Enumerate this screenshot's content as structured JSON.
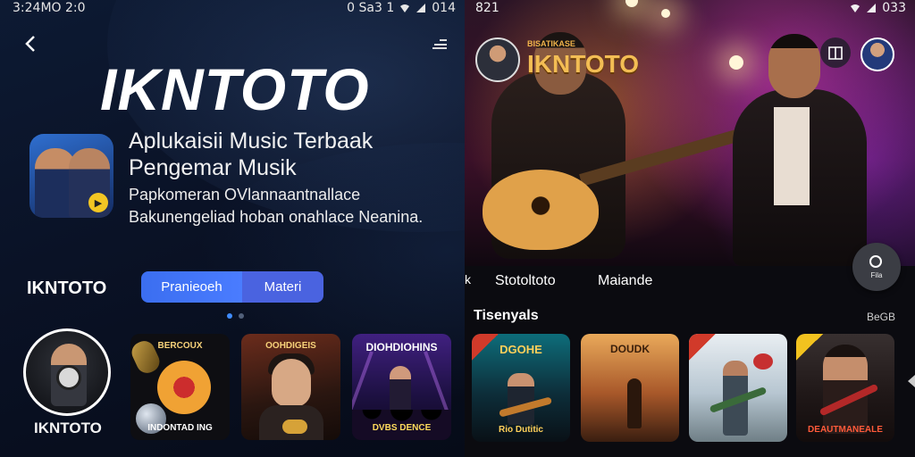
{
  "left": {
    "status": {
      "time": "3:24MO 2:0",
      "icons_text": "0 Sa3 1",
      "battery": "014"
    },
    "hero_title": "IKNTOTO",
    "headline": "Aplukaisii Music Terbaak Pengemar Musik",
    "description": "Papkomeran OVlannaantnallace Bakunengeliad hoban onahlace Neanina.",
    "nav": {
      "brand": "IKNTOTO",
      "pills": [
        "Pranieoeh",
        "Materi"
      ]
    },
    "avatar_label": "IKNTOTO",
    "tiles": [
      {
        "top": "BERCOUX",
        "bottom": "INDONTAD ING"
      },
      {
        "top": "OOHDIGEIS",
        "bottom": ""
      },
      {
        "top": "DIOHDIOHINS",
        "bottom": "DVBS DENCE"
      }
    ]
  },
  "right": {
    "status": {
      "time": "821",
      "battery": "033"
    },
    "brand_tag": "BISATIKASE",
    "brand_title": "IKNTOTO",
    "fab_label": "Fila",
    "nav": {
      "prefix": "k",
      "item1": "Stotoltoto",
      "item2": "Maiande"
    },
    "section_title": "Tisenyals",
    "see_all": "BeGB",
    "tiles": [
      {
        "top": "DGOHE",
        "bottom": "Rio Dutitic"
      },
      {
        "top": "DOUDK",
        "bottom": ""
      },
      {
        "top": "",
        "bottom": ""
      },
      {
        "top": "",
        "bottom": "DEAUTMANEALE"
      }
    ]
  },
  "colors": {
    "accent": "#3b6ef0",
    "pill2": "#4a63e0",
    "gold": "#f3bd54"
  },
  "icons": [
    "back-arrow-icon",
    "menu-dots-icon",
    "book-icon",
    "record-icon",
    "signal-icon",
    "wifi-icon",
    "battery-icon"
  ]
}
